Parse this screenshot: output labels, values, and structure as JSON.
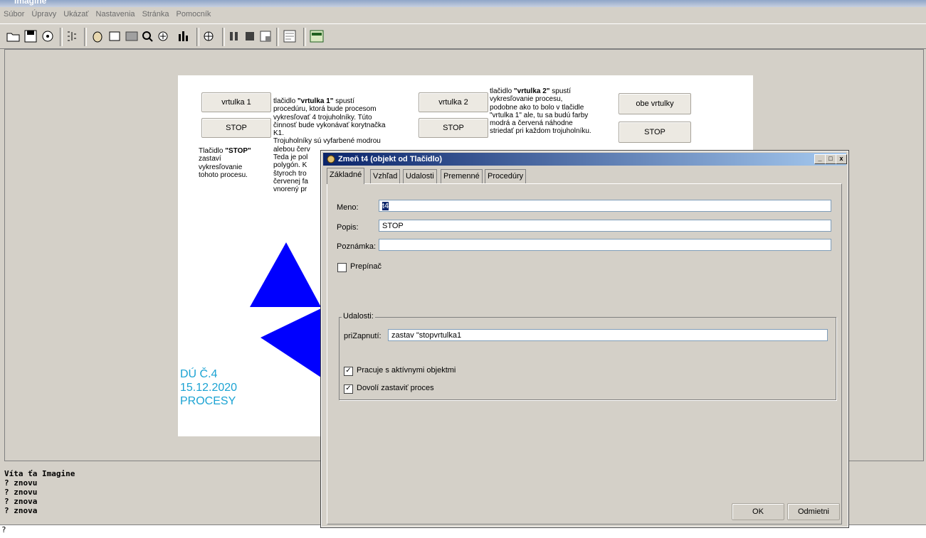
{
  "menu": [
    "Súbor",
    "Úpravy",
    "Ukázať",
    "Nastavenia",
    "Stránka",
    "Pomocník"
  ],
  "page": {
    "buttons": {
      "vrtulka1": "vrtulka 1",
      "stop1": "STOP",
      "vrtulka2": "vrtulka 2",
      "stop2": "STOP",
      "obe": "obe vrtulky",
      "stop3": "STOP"
    },
    "stop_note": {
      "bold": "\"STOP\"",
      "pre": "Tlačidlo ",
      "rest": "zastaví vykresľovanie\ntohoto procesu."
    },
    "text1": {
      "pre": "tlačidlo ",
      "bold": "\"vrtulka 1\"",
      "rest": " spustí\nprocedúru, ktorá bude procesom\nvykresľovať 4 trojuholníky. Túto\nčinnosť bude vykonávať korytnačka\nK1.\nTrojuholníky sú vyfarbené modrou\nalebou červ\nTeda je pol\npolygón. K\nštyroch tro\nčervenej fa\nvnorený pr"
    },
    "text2": {
      "pre": "tlačidlo ",
      "bold": "\"vrtulka 2\"",
      "rest": " spustí\nvykresľovanie procesu,\npodobne ako to bolo v tlačidle\n\"vrtulka 1\" ale, tu sa budú farby\nmodrá a červená náhodne\nstriedať pri každom trojuholníku."
    },
    "headline": [
      "DÚ Č.4",
      "15.12.2020",
      "PROCESY"
    ]
  },
  "console": {
    "lines": [
      "Víta ťa Imagine",
      "? znovu",
      "? znovu",
      "? znova",
      "? znova"
    ],
    "prompt": "?"
  },
  "dialog": {
    "title": "Zmeň t4 (objekt od Tlačidlo)",
    "tabs": [
      "Základné",
      "Vzhľad",
      "Udalosti",
      "Premenné",
      "Procedúry"
    ],
    "meno_label": "Meno:",
    "meno_value": "t4",
    "popis_label": "Popis:",
    "popis_value": "STOP",
    "poznamka_label": "Poznámka:",
    "poznamka_value": "",
    "prepinac_label": "Prepínač",
    "udalosti_label": "Udalosti:",
    "prizapnuti_label": "priZapnutí:",
    "prizapnuti_value": "zastav \"stopvrtulka1",
    "aktivne_label": "Pracuje s aktívnymi objektmi",
    "dovol_label": "Dovolí zastaviť proces",
    "ok_label": "OK",
    "cancel_label": "Odmietni"
  },
  "colors": {
    "triangle": "#0000ff",
    "headline": "#1ba3d3",
    "title_start": "#0a246a"
  },
  "icons": [
    "open-folder-icon",
    "save-icon",
    "settings-icon",
    "grid-icon",
    "turtle-icon",
    "button-icon",
    "rectangle-icon",
    "magnifier-icon",
    "slider-icon",
    "chart-icon",
    "wrench-icon",
    "pause-icon",
    "stop-icon",
    "window-icon",
    "dialog-icon",
    "panel-icon"
  ]
}
